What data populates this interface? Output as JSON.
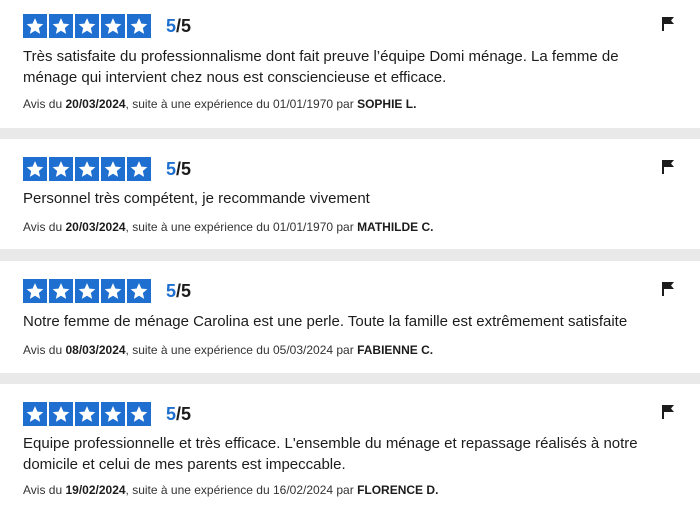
{
  "rating_color": "#1e6fd0",
  "reviews": [
    {
      "score": "5",
      "max": "/5",
      "text": "Très satisfaite du professionnalisme dont fait preuve l’équipe Domi ménage. La femme de ménage qui intervient chez nous est consciencieuse et efficace.",
      "meta_prefix": "Avis du",
      "review_date": "20/03/2024",
      "meta_middle": ", suite à une expérience du 01/01/1970 par",
      "author": "SOPHIE L."
    },
    {
      "score": "5",
      "max": "/5",
      "text": "Personnel très compétent, je recommande vivement",
      "meta_prefix": "Avis du",
      "review_date": "20/03/2024",
      "meta_middle": ", suite à une expérience du 01/01/1970 par",
      "author": "MATHILDE C."
    },
    {
      "score": "5",
      "max": "/5",
      "text": "Notre femme de ménage Carolina est une perle. Toute la famille est extrêmement satisfaite",
      "meta_prefix": "Avis du",
      "review_date": "08/03/2024",
      "meta_middle": ", suite à une expérience du 05/03/2024 par",
      "author": "FABIENNE C."
    },
    {
      "score": "5",
      "max": "/5",
      "text": "Equipe professionnelle et très efficace. L'ensemble du ménage et repassage réalisés à notre domicile et celui de mes parents est impeccable.",
      "meta_prefix": "Avis du",
      "review_date": "19/02/2024",
      "meta_middle": ", suite à une expérience du 16/02/2024 par",
      "author": "FLORENCE D."
    }
  ]
}
